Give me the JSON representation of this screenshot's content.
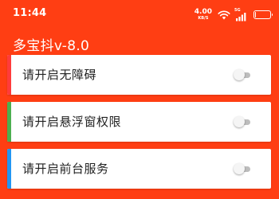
{
  "status_bar": {
    "time": "11:44",
    "net_speed": "4.00",
    "net_speed_unit": "KB/S",
    "network_type": "5G",
    "battery_level": "1",
    "battery_fraction": 0.06,
    "icons": [
      "wifi-icon",
      "signal-icon",
      "battery-icon"
    ]
  },
  "app": {
    "title": "多宝抖v-8.0",
    "background_color": "#ff3e13"
  },
  "settings": [
    {
      "label": "请开启无障碍",
      "accent_color": "#ff3b3b",
      "toggle_on": false
    },
    {
      "label": "请开启悬浮窗权限",
      "accent_color": "#4caf50",
      "toggle_on": false
    },
    {
      "label": "请开启前台服务",
      "accent_color": "#2196f3",
      "toggle_on": false
    }
  ]
}
